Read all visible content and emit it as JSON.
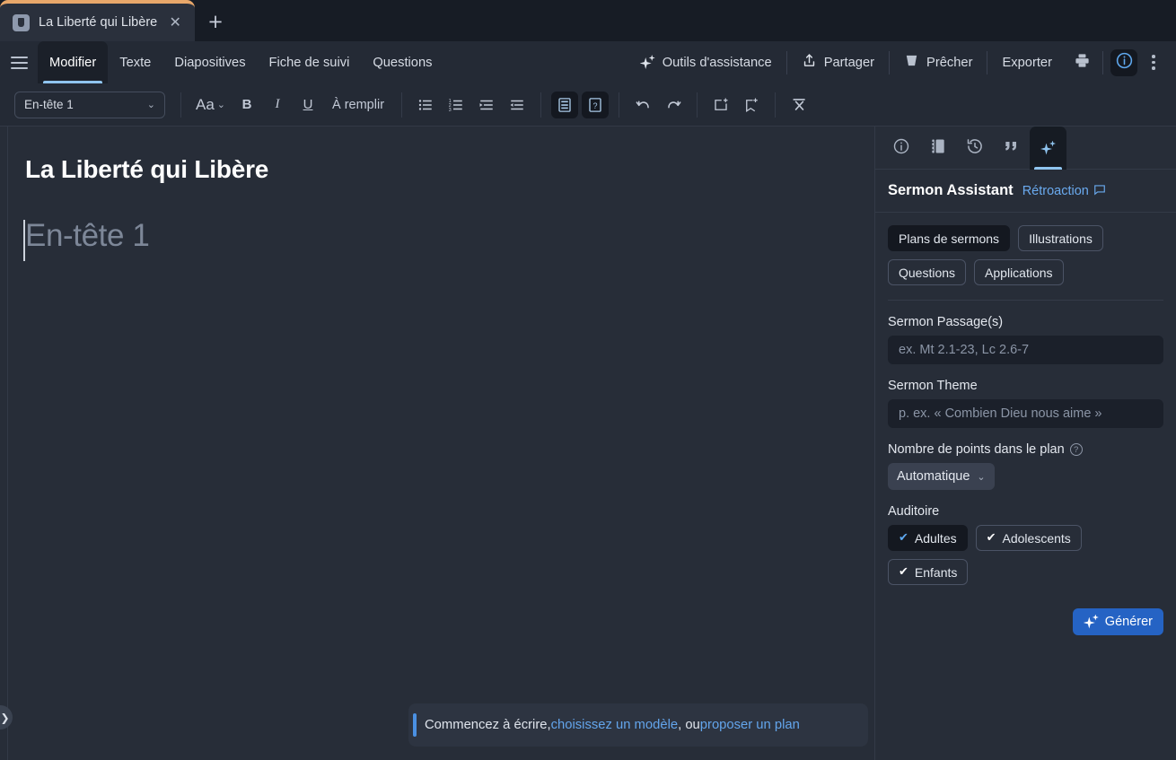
{
  "window": {
    "tab": {
      "title": "La Liberté qui Libère",
      "close_label": "✕",
      "new_tab_label": "+"
    }
  },
  "menubar": {
    "items": [
      {
        "label": "Modifier",
        "active": true
      },
      {
        "label": "Texte",
        "active": false
      },
      {
        "label": "Diapositives",
        "active": false
      },
      {
        "label": "Fiche de suivi",
        "active": false
      },
      {
        "label": "Questions",
        "active": false
      }
    ],
    "right": {
      "assist_tools": "Outils d'assistance",
      "share": "Partager",
      "preach": "Prêcher",
      "export": "Exporter"
    }
  },
  "toolbar": {
    "style_value": "En-tête 1",
    "fill_label": "À remplir",
    "font_size_label": "Aa"
  },
  "editor": {
    "doc_title": "La Liberté qui Libère",
    "body_placeholder": "En-tête 1",
    "hint": {
      "prefix": "Commencez à écrire, ",
      "link1": "choisissez un modèle",
      "middle": ", ou ",
      "link2": "proposer un plan"
    }
  },
  "panel": {
    "title": "Sermon Assistant",
    "feedback": "Rétroaction",
    "chips": [
      {
        "label": "Plans de sermons",
        "selected": true
      },
      {
        "label": "Illustrations",
        "selected": false
      },
      {
        "label": "Questions",
        "selected": false
      },
      {
        "label": "Applications",
        "selected": false
      }
    ],
    "passage": {
      "label": "Sermon Passage(s)",
      "placeholder": "ex. Mt 2.1-23, Lc 2.6-7",
      "value": ""
    },
    "theme": {
      "label": "Sermon Theme",
      "placeholder": "p. ex. « Combien Dieu nous aime »",
      "value": ""
    },
    "points": {
      "label": "Nombre de points dans le plan",
      "help": "?",
      "value": "Automatique"
    },
    "audience": {
      "label": "Auditoire",
      "options": [
        {
          "label": "Adultes",
          "selected": true
        },
        {
          "label": "Adolescents",
          "selected": false
        },
        {
          "label": "Enfants",
          "selected": false
        }
      ]
    },
    "generate_label": "Générer"
  },
  "colors": {
    "tab_accent": "#e8a76a",
    "active_underline": "#8fc4ef",
    "link": "#63a5ec",
    "primary_button": "#2563c4",
    "panel_bg": "#272d38",
    "chrome_bg": "#242a35"
  }
}
